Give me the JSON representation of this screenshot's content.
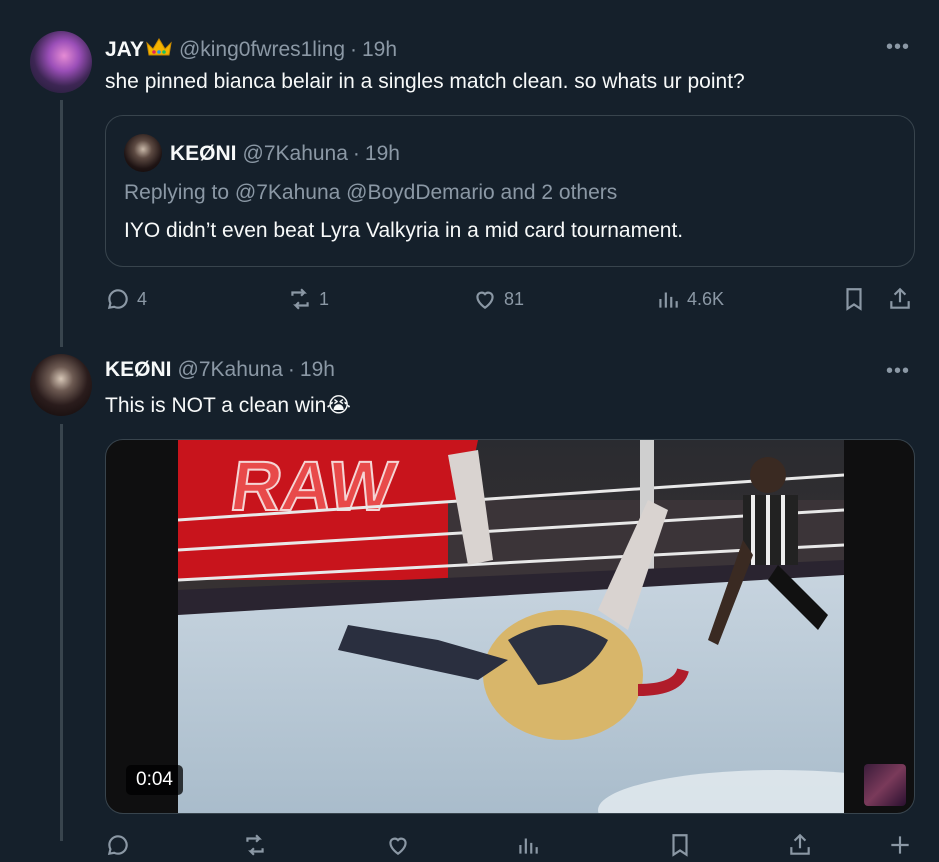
{
  "tweet1": {
    "name": "JAY",
    "crown": "👑",
    "handle": "@king0fwres1ling",
    "dot": "·",
    "time": "19h",
    "text": "she pinned bianca belair in a singles match clean. so whats ur point?",
    "more": "•••",
    "quote": {
      "name": "KEØNI",
      "handle": "@7Kahuna",
      "dot": "·",
      "time": "19h",
      "replying_prefix": "Replying to",
      "replying_mentions": "@7Kahuna @BoydDemario",
      "replying_suffix": "and 2 others",
      "text": "IYO didn’t even beat Lyra Valkyria in a mid card tournament."
    },
    "actions": {
      "replies": "4",
      "reposts": "1",
      "likes": "81",
      "views": "4.6K"
    }
  },
  "tweet2": {
    "name": "KEØNI",
    "handle": "@7Kahuna",
    "dot": "·",
    "time": "19h",
    "text": "This is NOT a clean win",
    "emoji": "😭",
    "more": "•••",
    "media": {
      "duration": "0:04",
      "banner_text": "RAW"
    }
  },
  "icons": [
    "reply-icon",
    "repost-icon",
    "like-icon",
    "views-icon",
    "bookmark-icon",
    "share-icon",
    "more-icon"
  ],
  "colors": {
    "background": "#15202b",
    "text": "#f7f9f9",
    "muted": "#8b98a5",
    "border": "#38444d"
  }
}
